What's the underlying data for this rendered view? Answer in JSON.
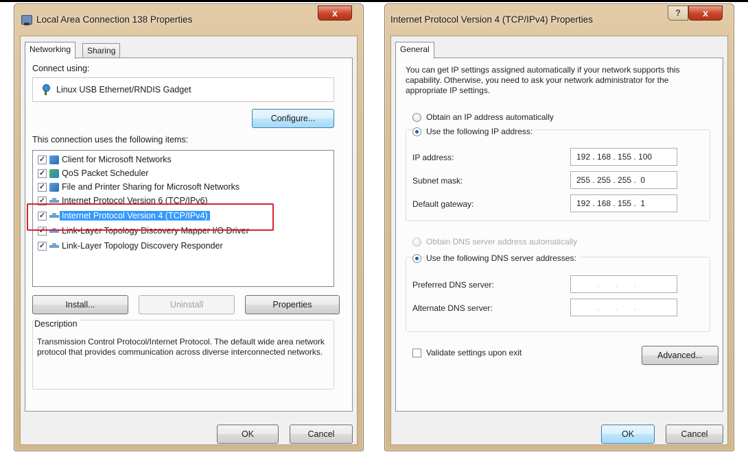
{
  "left_dialog": {
    "title": "Local Area Connection 138 Properties",
    "close_label": "x",
    "tabs": [
      "Networking",
      "Sharing"
    ],
    "connect_using_label": "Connect using:",
    "adapter_name": "Linux USB Ethernet/RNDIS Gadget",
    "configure_label": "Configure...",
    "items_label": "This connection uses the following items:",
    "items": [
      {
        "label": "Client for Microsoft Networks",
        "checked": true,
        "icon": "network-client-icon"
      },
      {
        "label": "QoS Packet Scheduler",
        "checked": true,
        "icon": "qos-icon"
      },
      {
        "label": "File and Printer Sharing for Microsoft Networks",
        "checked": true,
        "icon": "file-printer-sharing-icon"
      },
      {
        "label": "Internet Protocol Version 6 (TCP/IPv6)",
        "checked": true,
        "icon": "protocol-icon"
      },
      {
        "label": "Internet Protocol Version 4 (TCP/IPv4)",
        "checked": true,
        "icon": "protocol-icon",
        "selected": true
      },
      {
        "label": "Link-Layer Topology Discovery Mapper I/O Driver",
        "checked": true,
        "icon": "protocol-icon"
      },
      {
        "label": "Link-Layer Topology Discovery Responder",
        "checked": true,
        "icon": "protocol-icon"
      }
    ],
    "install_label": "Install...",
    "uninstall_label": "Uninstall",
    "properties_label": "Properties",
    "description_title": "Description",
    "description_text": "Transmission Control Protocol/Internet Protocol. The default wide area network protocol that provides communication across diverse interconnected networks.",
    "ok_label": "OK",
    "cancel_label": "Cancel",
    "highlight_color": "#d6222f",
    "selection_color": "#3399ff"
  },
  "right_dialog": {
    "title": "Internet Protocol Version 4 (TCP/IPv4) Properties",
    "help_label": "?",
    "close_label": "x",
    "tab": "General",
    "intro_text": "You can get IP settings assigned automatically if your network supports this capability. Otherwise, you need to ask your network administrator for the appropriate IP settings.",
    "obtain_ip_auto_label": "Obtain an IP address automatically",
    "use_ip_label": "Use the following IP address:",
    "ip_address_label": "IP address:",
    "ip_address_value": "192 . 168 . 155 . 100",
    "subnet_mask_label": "Subnet mask:",
    "subnet_mask_value": "255 . 255 . 255 .  0",
    "gateway_label": "Default gateway:",
    "gateway_value": "192 . 168 . 155 .  1",
    "obtain_dns_auto_label": "Obtain DNS server address automatically",
    "use_dns_label": "Use the following DNS server addresses:",
    "preferred_dns_label": "Preferred DNS server:",
    "preferred_dns_value": ".       .       .",
    "alternate_dns_label": "Alternate DNS server:",
    "alternate_dns_value": ".       .       .",
    "validate_label": "Validate settings upon exit",
    "advanced_label": "Advanced...",
    "ok_label": "OK",
    "cancel_label": "Cancel",
    "selected_ip_mode": "static",
    "selected_dns_mode": "static"
  }
}
